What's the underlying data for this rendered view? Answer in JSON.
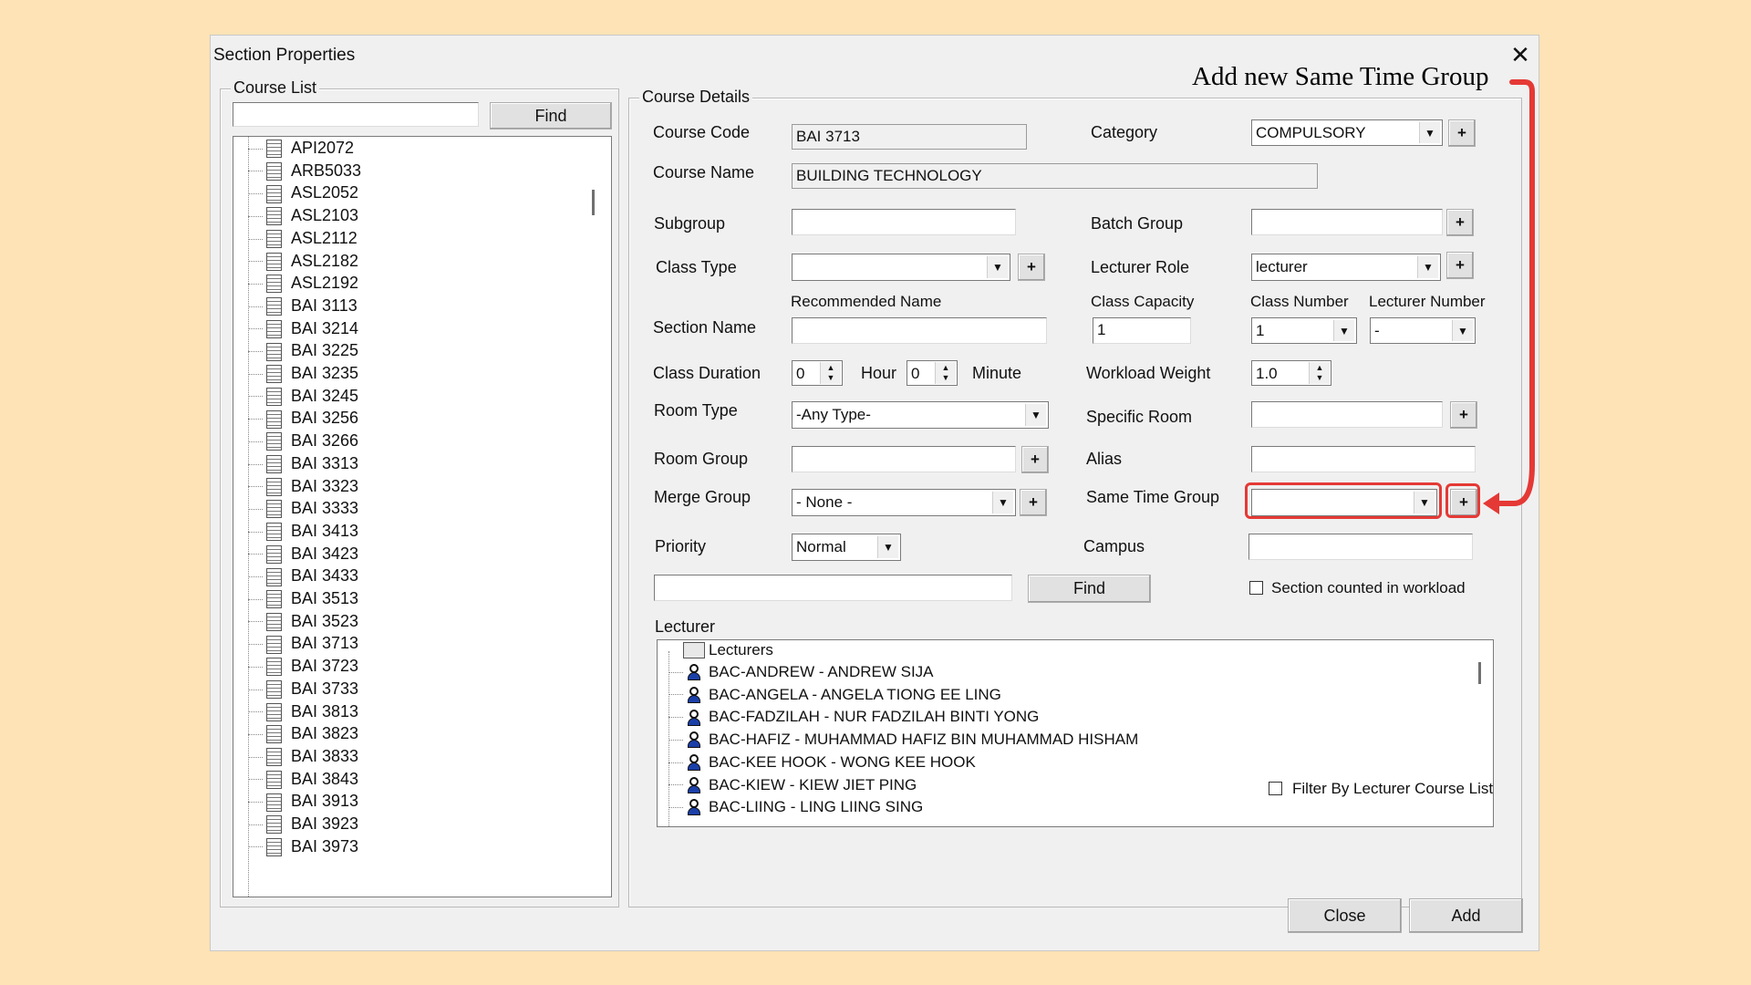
{
  "dialog": {
    "title": "Section Properties",
    "close_glyph": "✕",
    "close_label": "Close",
    "add_label": "Add"
  },
  "course_list": {
    "legend": "Course List",
    "search_value": "",
    "find_label": "Find",
    "items": [
      "API2072",
      "ARB5033",
      "ASL2052",
      "ASL2103",
      "ASL2112",
      "ASL2182",
      "ASL2192",
      "BAI 3113",
      "BAI 3214",
      "BAI 3225",
      "BAI 3235",
      "BAI 3245",
      "BAI 3256",
      "BAI 3266",
      "BAI 3313",
      "BAI 3323",
      "BAI 3333",
      "BAI 3413",
      "BAI 3423",
      "BAI 3433",
      "BAI 3513",
      "BAI 3523",
      "BAI 3713",
      "BAI 3723",
      "BAI 3733",
      "BAI 3813",
      "BAI 3823",
      "BAI 3833",
      "BAI 3843",
      "BAI 3913",
      "BAI 3923",
      "BAI 3973"
    ]
  },
  "details": {
    "legend": "Course Details",
    "course_code_label": "Course Code",
    "course_code": "BAI 3713",
    "course_name_label": "Course Name",
    "course_name": "BUILDING TECHNOLOGY",
    "category_label": "Category",
    "category": "COMPULSORY",
    "subgroup_label": "Subgroup",
    "subgroup": "",
    "batch_group_label": "Batch Group",
    "batch_group": "",
    "class_type_label": "Class Type",
    "class_type": "",
    "lecturer_role_label": "Lecturer Role",
    "lecturer_role": "lecturer",
    "recommended_name_label": "Recommended Name",
    "class_capacity_label": "Class Capacity",
    "class_number_label": "Class Number",
    "lecturer_number_label": "Lecturer Number",
    "section_name_label": "Section Name",
    "section_name": "",
    "class_capacity": "1",
    "class_number": "1",
    "lecturer_number": "-",
    "class_duration_label": "Class Duration",
    "duration_hour": "0",
    "hour_label": "Hour",
    "duration_minute": "0",
    "minute_label": "Minute",
    "workload_weight_label": "Workload Weight",
    "workload_weight": "1.0",
    "room_type_label": "Room Type",
    "room_type": "-Any Type-",
    "specific_room_label": "Specific Room",
    "specific_room": "",
    "room_group_label": "Room Group",
    "room_group": "",
    "alias_label": "Alias",
    "alias": "",
    "merge_group_label": "Merge Group",
    "merge_group": "- None -",
    "same_time_group_label": "Same Time Group",
    "same_time_group": "",
    "priority_label": "Priority",
    "priority": "Normal",
    "campus_label": "Campus",
    "campus": "",
    "lecturer_search": "",
    "find_label": "Find",
    "workload_check_label": "Section counted in workload",
    "plus": "+",
    "arrow": "▼"
  },
  "lecturer": {
    "label": "Lecturer",
    "root": "Lecturers",
    "items": [
      "BAC-ANDREW - ANDREW SIJA",
      "BAC-ANGELA - ANGELA TIONG EE LING",
      "BAC-FADZILAH - NUR FADZILAH BINTI YONG",
      "BAC-HAFIZ - MUHAMMAD HAFIZ BIN MUHAMMAD HISHAM",
      "BAC-KEE HOOK - WONG KEE HOOK",
      "BAC-KIEW - KIEW JIET PING",
      "BAC-LIING - LING LIING SING"
    ],
    "filter_label": "Filter By Lecturer Course List"
  },
  "annotation": {
    "text": "Add new Same Time Group",
    "color": "#e53935"
  }
}
